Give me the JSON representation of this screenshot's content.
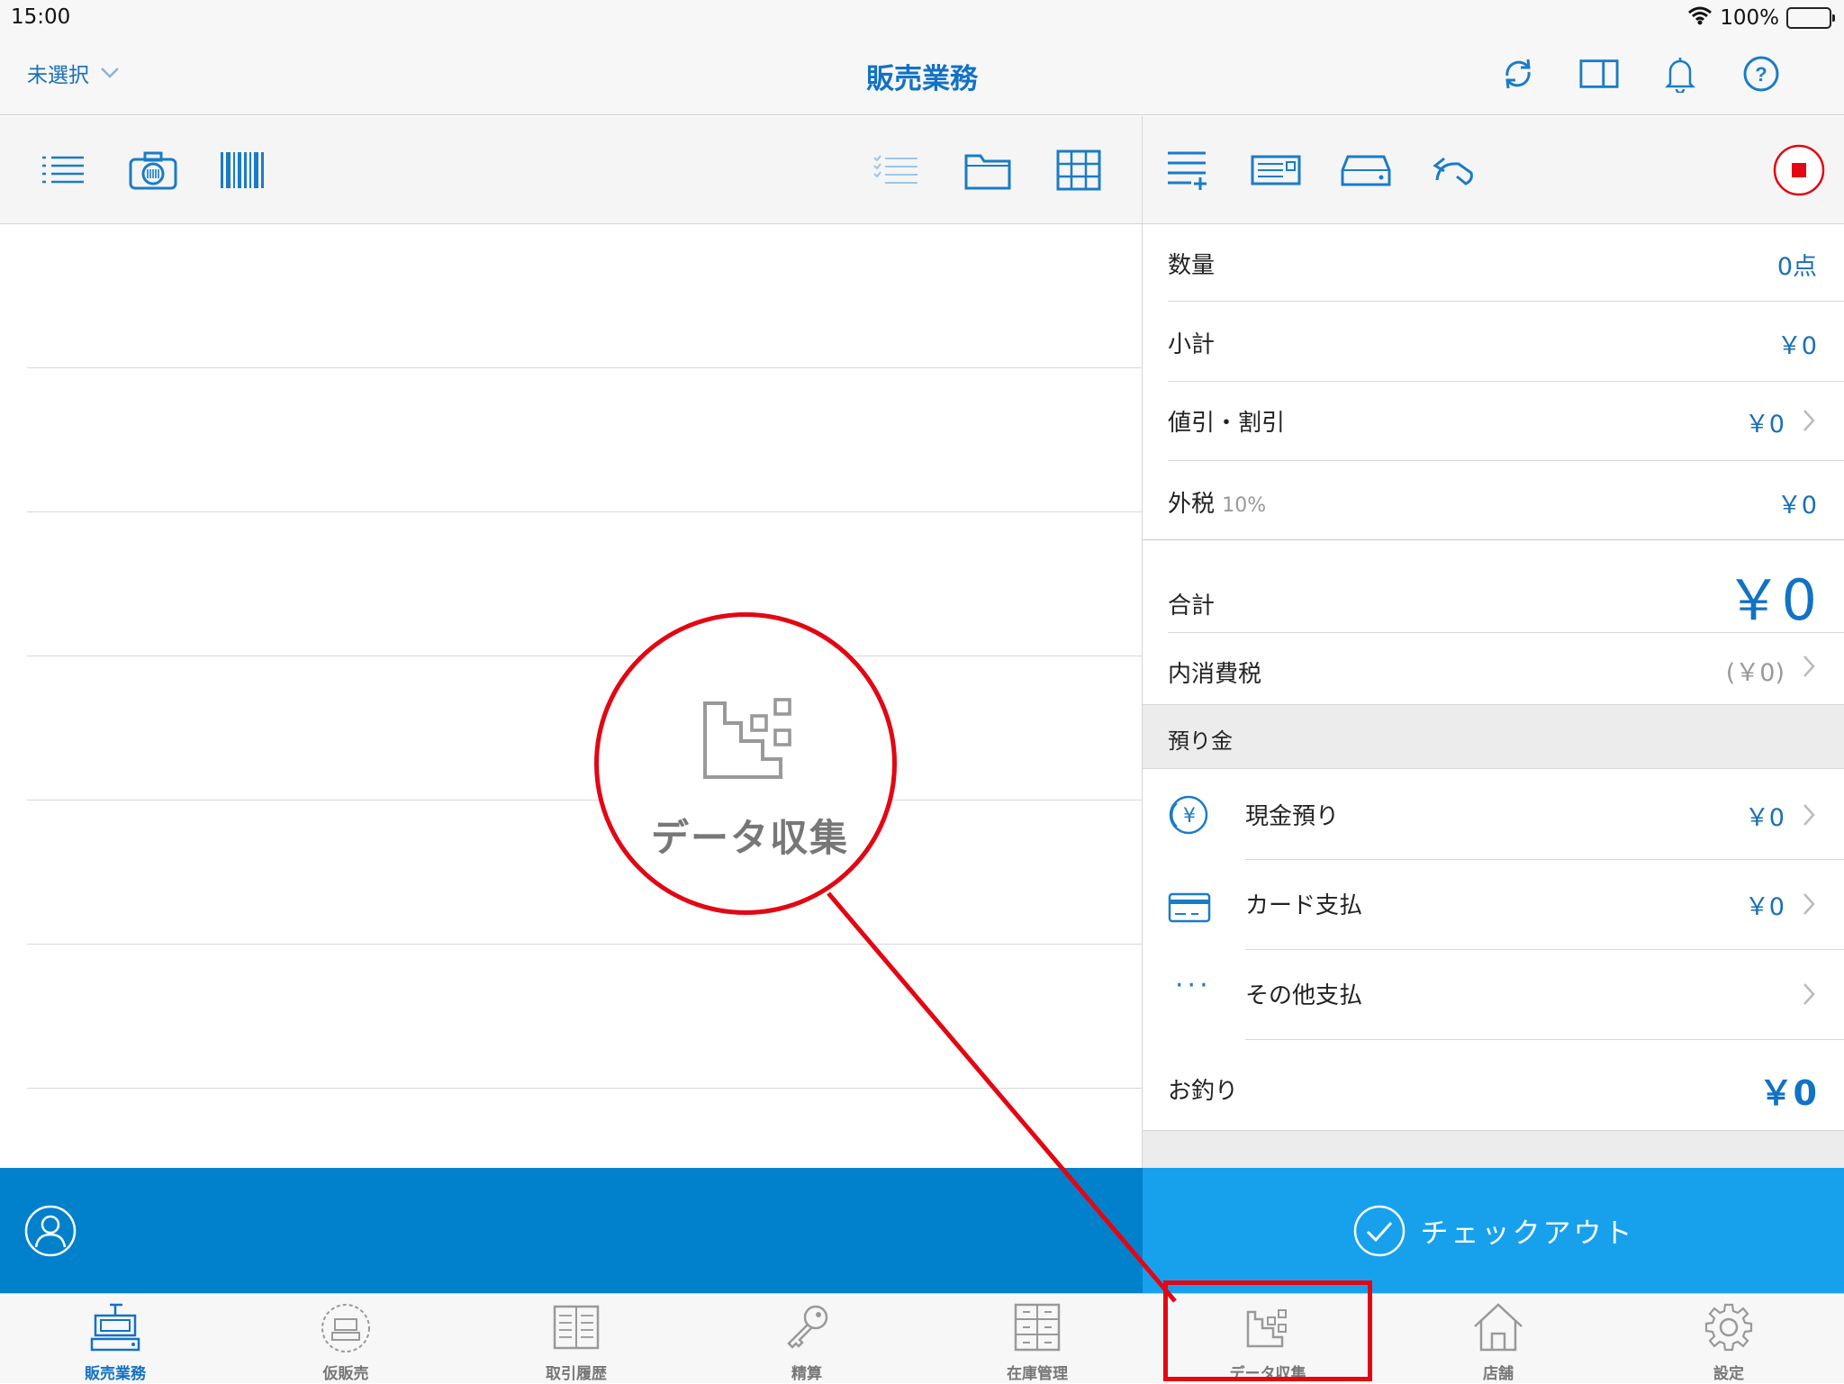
{
  "status_bar": {
    "time": "15:00",
    "battery": "100%"
  },
  "navbar": {
    "store_select": "未選択",
    "title": "販売業務",
    "icons": [
      "sync-icon",
      "split-view-icon",
      "bell-icon",
      "help-icon"
    ]
  },
  "left_toolbar": {
    "left_icons": [
      "list-icon",
      "camera-icon",
      "barcode-icon"
    ],
    "right_icons": [
      "checklist-icon",
      "folder-icon",
      "grid-icon"
    ]
  },
  "right_toolbar": {
    "icons": [
      "add-line-icon",
      "receipt-printer-icon",
      "cash-drawer-icon",
      "return-icon",
      "stop-icon"
    ]
  },
  "summary": {
    "quantity": {
      "label": "数量",
      "value": "0点"
    },
    "subtotal": {
      "label": "小計",
      "value": "￥0"
    },
    "discount": {
      "label": "値引・割引",
      "value": "￥0"
    },
    "tax": {
      "label": "外税",
      "rate": "10%",
      "value": "￥0"
    },
    "total": {
      "label": "合計",
      "value": "￥0"
    },
    "inner_tax": {
      "label": "内消費税",
      "value": "(￥0)"
    },
    "deposit_header": "預り金",
    "cash": {
      "label": "現金預り",
      "value": "￥0"
    },
    "card": {
      "label": "カード支払",
      "value": "￥0"
    },
    "other": {
      "label": "その他支払"
    },
    "change": {
      "label": "お釣り",
      "value": "￥0"
    }
  },
  "checkout": {
    "label": "チェックアウト"
  },
  "tabs": [
    {
      "label": "販売業務",
      "icon": "register-icon",
      "active": true
    },
    {
      "label": "仮販売",
      "icon": "temp-sale-icon",
      "active": false
    },
    {
      "label": "取引履歴",
      "icon": "history-book-icon",
      "active": false
    },
    {
      "label": "精算",
      "icon": "key-icon",
      "active": false
    },
    {
      "label": "在庫管理",
      "icon": "inventory-icon",
      "active": false
    },
    {
      "label": "データ収集",
      "icon": "data-collection-icon",
      "active": false
    },
    {
      "label": "店舗",
      "icon": "store-icon",
      "active": false
    },
    {
      "label": "設定",
      "icon": "gear-icon",
      "active": false
    }
  ],
  "callout": {
    "label": "データ収集"
  },
  "colors": {
    "accent": "#1272c4",
    "bottom_bar": "#0181cc",
    "checkout": "#17a1ec",
    "highlight": "#e30613"
  }
}
